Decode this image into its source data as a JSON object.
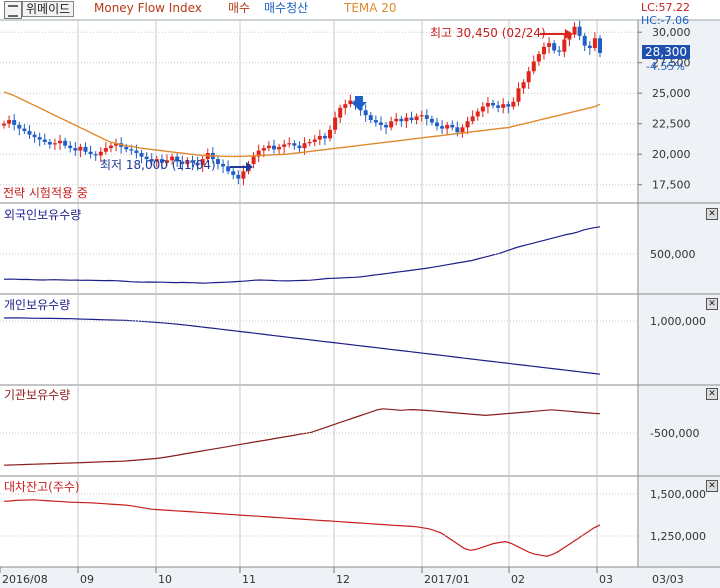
{
  "header": {
    "stock_name": "위메이드",
    "indicator": "Money Flow Index",
    "buy_label": "매수",
    "sell_label": "매수청산",
    "tema_label": "TEMA 20",
    "lc": "LC:57.22",
    "hc": "HC:-7.06"
  },
  "colors": {
    "up": "#e0241a",
    "down": "#1f5fc7",
    "tema": "#e08a2e",
    "navy": "#1e1f8a",
    "maroon": "#8b1c1c",
    "red": "#c81e1e",
    "grid": "#c8c8c8",
    "axis_bg": "#eef1f6"
  },
  "chart_data": [
    {
      "type": "candlestick",
      "name": "price",
      "x_ticks": [
        "2016/08",
        "09",
        "10",
        "11",
        "12",
        "2017/01",
        "02",
        "03",
        "03/03"
      ],
      "y_ticks": [
        30000,
        27500,
        25000,
        22500,
        20000,
        17500
      ],
      "y_tick_labels": [
        "30,000",
        "27,500",
        "25,000",
        "22,500",
        "20,000",
        "17,500"
      ],
      "ylim": [
        16000,
        31000
      ],
      "close_series": [
        22500,
        22800,
        22400,
        22100,
        21900,
        21600,
        21400,
        21200,
        21000,
        20800,
        20900,
        21100,
        20700,
        20500,
        20300,
        20600,
        20200,
        20000,
        19900,
        20200,
        20500,
        20700,
        20900,
        20600,
        20400,
        20300,
        20100,
        19800,
        19600,
        19400,
        19600,
        19300,
        19500,
        19800,
        19400,
        19200,
        19500,
        19300,
        19100,
        19600,
        20100,
        19600,
        19200,
        19000,
        18600,
        18300,
        18000,
        18600,
        19200,
        19800,
        20300,
        20500,
        20700,
        20400,
        20600,
        20800,
        20900,
        20700,
        20500,
        20900,
        21000,
        21200,
        21500,
        21300,
        22000,
        23000,
        23800,
        24100,
        24400,
        24000,
        23600,
        23200,
        22800,
        22600,
        22400,
        22200,
        22700,
        22900,
        22700,
        23000,
        22800,
        23100,
        23200,
        22900,
        22600,
        22300,
        22100,
        22400,
        22200,
        21800,
        22200,
        22700,
        23100,
        23500,
        23900,
        24200,
        24000,
        23800,
        24100,
        23900,
        24300,
        25400,
        25900,
        26800,
        27600,
        28200,
        28800,
        29100,
        28500,
        28400,
        29400,
        29800,
        30450,
        29700,
        28900,
        28700,
        29500,
        28300
      ],
      "tema_series": [
        25100,
        24950,
        24800,
        24600,
        24400,
        24200,
        24000,
        23800,
        23600,
        23400,
        23200,
        23000,
        22800,
        22600,
        22400,
        22200,
        22000,
        21800,
        21600,
        21400,
        21200,
        21000,
        20900,
        20800,
        20700,
        20650,
        20600,
        20500,
        20450,
        20400,
        20350,
        20300,
        20250,
        20200,
        20150,
        20100,
        20050,
        20000,
        19950,
        19920,
        19900,
        19880,
        19860,
        19840,
        19830,
        19820,
        19820,
        19830,
        19840,
        19860,
        19880,
        19900,
        19920,
        19940,
        19960,
        19980,
        20000,
        20050,
        20100,
        20150,
        20200,
        20250,
        20300,
        20350,
        20400,
        20450,
        20500,
        20550,
        20600,
        20650,
        20700,
        20750,
        20800,
        20850,
        20900,
        20950,
        21000,
        21050,
        21100,
        21150,
        21200,
        21250,
        21300,
        21350,
        21400,
        21450,
        21500,
        21550,
        21600,
        21650,
        21700,
        21750,
        21800,
        21850,
        21900,
        21950,
        22000,
        22050,
        22100,
        22150,
        22200,
        22300,
        22400,
        22500,
        22600,
        22700,
        22800,
        22900,
        23000,
        23100,
        23200,
        23300,
        23400,
        23500,
        23600,
        23700,
        23800,
        23900,
        24100
      ],
      "current_price": "28,300",
      "current_change": "-4.55%",
      "annotations": {
        "high": "최고 30,450 (02/24)",
        "low": "최저 18,000 (11/04)",
        "strategy": "전략 시험적용 중"
      }
    },
    {
      "type": "line",
      "name": "외국인보유수량",
      "y_tick_labels": [
        "500,000"
      ],
      "values": [
        370,
        372,
        371,
        368,
        369,
        366,
        364,
        363,
        365,
        366,
        364,
        362,
        360,
        361,
        359,
        360,
        358,
        357,
        356,
        357,
        355,
        352,
        348,
        344,
        342,
        340,
        342,
        341,
        340,
        339,
        337,
        335,
        338,
        336,
        334,
        331,
        329,
        333,
        336,
        338,
        340,
        343,
        347,
        350,
        355,
        360,
        362,
        360,
        358,
        355,
        354,
        353,
        355,
        357,
        358,
        360,
        366,
        372,
        378,
        380,
        382,
        385,
        388,
        390,
        395,
        402,
        410,
        418,
        425,
        432,
        440,
        448,
        455,
        462,
        470,
        478,
        486,
        495,
        505,
        515,
        525,
        535,
        545,
        555,
        565,
        580,
        595,
        610,
        625,
        640,
        660,
        680,
        700,
        715,
        730,
        745,
        760,
        775,
        790,
        805,
        820,
        835,
        845,
        860,
        880,
        895,
        905,
        915
      ]
    },
    {
      "type": "line",
      "name": "개인보유수량",
      "y_tick_labels": [
        "1,000,000"
      ],
      "values": [
        1140,
        1142,
        1141,
        1140,
        1138,
        1137,
        1136,
        1136,
        1135,
        1134,
        1133,
        1130,
        1128,
        1126,
        1124,
        1122,
        1120,
        1118,
        1116,
        1112,
        1108,
        1103,
        1098,
        1093,
        1088,
        1082,
        1075,
        1068,
        1060,
        1052,
        1044,
        1036,
        1028,
        1020,
        1012,
        1004,
        996,
        988,
        980,
        972,
        964,
        956,
        948,
        940,
        932,
        924,
        916,
        908,
        900,
        892,
        884,
        876,
        868,
        860,
        852,
        844,
        836,
        828,
        820,
        812,
        804,
        796,
        788,
        780,
        772,
        764,
        756,
        748,
        740,
        732,
        724,
        716,
        708,
        700,
        692,
        684,
        676,
        668,
        660,
        652,
        644,
        636,
        628,
        620,
        612,
        604,
        596,
        588,
        580
      ]
    },
    {
      "type": "line",
      "name": "기관보유수량",
      "y_tick_labels": [
        "-500,000"
      ],
      "values": [
        -840,
        -838,
        -836,
        -834,
        -832,
        -830,
        -828,
        -826,
        -824,
        -822,
        -820,
        -818,
        -816,
        -814,
        -812,
        -810,
        -808,
        -806,
        -804,
        -802,
        -800,
        -795,
        -790,
        -785,
        -780,
        -775,
        -770,
        -760,
        -750,
        -740,
        -730,
        -720,
        -710,
        -700,
        -690,
        -680,
        -670,
        -660,
        -650,
        -640,
        -630,
        -620,
        -610,
        -600,
        -590,
        -580,
        -570,
        -560,
        -550,
        -540,
        -530,
        -520,
        -500,
        -480,
        -460,
        -440,
        -420,
        -400,
        -380,
        -360,
        -340,
        -320,
        -300,
        -290,
        -295,
        -300,
        -305,
        -300,
        -298,
        -302,
        -306,
        -310,
        -315,
        -320,
        -325,
        -330,
        -335,
        -340,
        -345,
        -350,
        -355,
        -350,
        -345,
        -340,
        -335,
        -330,
        -325,
        -320,
        -315,
        -310,
        -305,
        -300,
        -305,
        -310,
        -315,
        -320,
        -325,
        -330,
        -335,
        -338
      ]
    },
    {
      "type": "line",
      "name": "대차잔고(주수)",
      "y_tick_labels": [
        "1,500,000",
        "1,250,000"
      ],
      "values": [
        1480,
        1482,
        1485,
        1486,
        1487,
        1488,
        1486,
        1484,
        1482,
        1480,
        1478,
        1476,
        1475,
        1474,
        1473,
        1472,
        1470,
        1468,
        1466,
        1464,
        1462,
        1460,
        1455,
        1450,
        1445,
        1440,
        1438,
        1436,
        1434,
        1432,
        1430,
        1428,
        1426,
        1424,
        1422,
        1420,
        1418,
        1416,
        1414,
        1412,
        1410,
        1408,
        1406,
        1404,
        1402,
        1400,
        1398,
        1396,
        1394,
        1392,
        1390,
        1388,
        1386,
        1384,
        1382,
        1380,
        1378,
        1376,
        1374,
        1372,
        1370,
        1368,
        1366,
        1364,
        1362,
        1360,
        1358,
        1356,
        1354,
        1352,
        1350,
        1345,
        1340,
        1330,
        1320,
        1300,
        1280,
        1260,
        1240,
        1230,
        1235,
        1245,
        1255,
        1265,
        1270,
        1275,
        1265,
        1250,
        1235,
        1220,
        1210,
        1205,
        1200,
        1210,
        1225,
        1245,
        1265,
        1285,
        1305,
        1325,
        1345,
        1360
      ]
    }
  ]
}
